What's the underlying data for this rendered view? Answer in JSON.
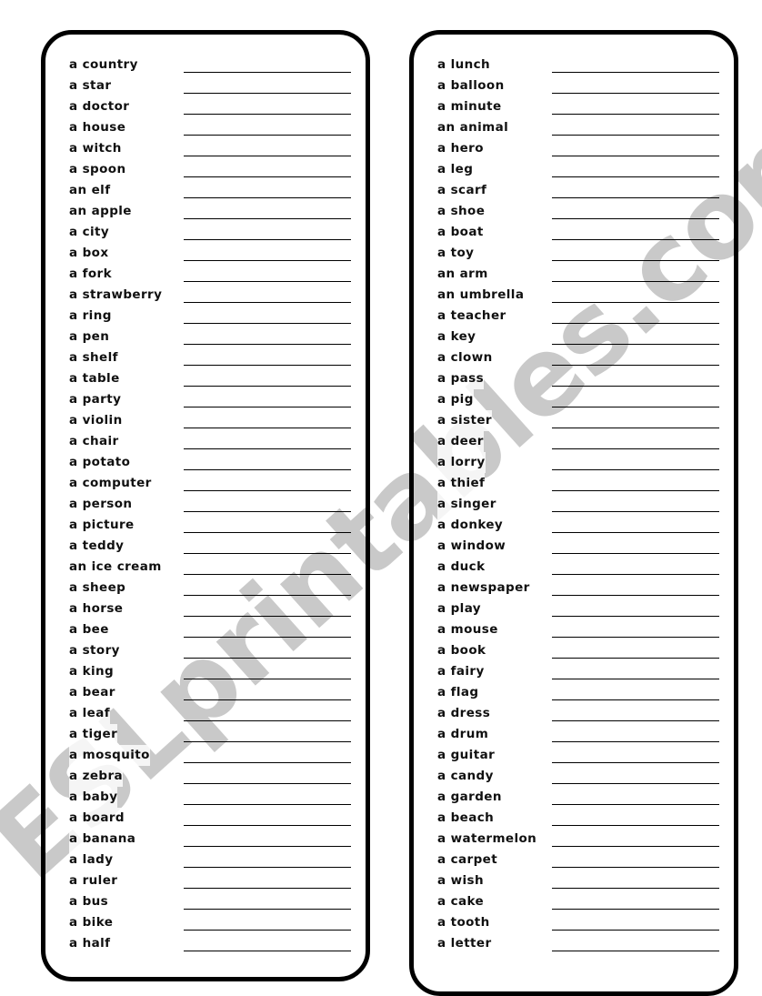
{
  "watermark": {
    "text": "ESLprintables.com",
    "color": "#c9c9c9"
  },
  "page": {
    "border_color": "#000000",
    "text_color": "#101010",
    "background": "#ffffff"
  },
  "worksheet": {
    "left_panel": {
      "items": [
        "a country",
        "a star",
        "a doctor",
        "a house",
        "a witch",
        "a spoon",
        "an elf",
        "an apple",
        "a city",
        "a box",
        "a fork",
        "a strawberry",
        "a ring",
        "a pen",
        "a shelf",
        "a table",
        "a party",
        "a violin",
        "a chair",
        "a potato",
        "a computer",
        "a person",
        "a picture",
        "a teddy",
        "an ice cream",
        "a sheep",
        "a horse",
        "a bee",
        "a story",
        "a king",
        "a bear",
        "a leaf",
        "a tiger",
        "a mosquito",
        "a zebra",
        "a baby",
        "a board",
        "a banana",
        "a lady",
        "a ruler",
        "a bus",
        "a bike",
        "a half"
      ]
    },
    "right_panel": {
      "items": [
        "a lunch",
        "a balloon",
        "a minute",
        "an animal",
        "a hero",
        "a leg",
        "a scarf",
        "a shoe",
        "a boat",
        "a toy",
        "an arm",
        "an umbrella",
        "a teacher",
        "a key",
        "a clown",
        "a pass",
        "a pig",
        "a sister",
        "a deer",
        "a lorry",
        "a thief",
        "a singer",
        "a donkey",
        "a window",
        "a duck",
        "a newspaper",
        "a play",
        "a mouse",
        "a book",
        "a fairy",
        "a flag",
        "a dress",
        "a drum",
        "a guitar",
        "a candy",
        "a garden",
        "a beach",
        "a watermelon",
        "a carpet",
        "a wish",
        "a cake",
        "a tooth",
        "a letter"
      ]
    }
  }
}
